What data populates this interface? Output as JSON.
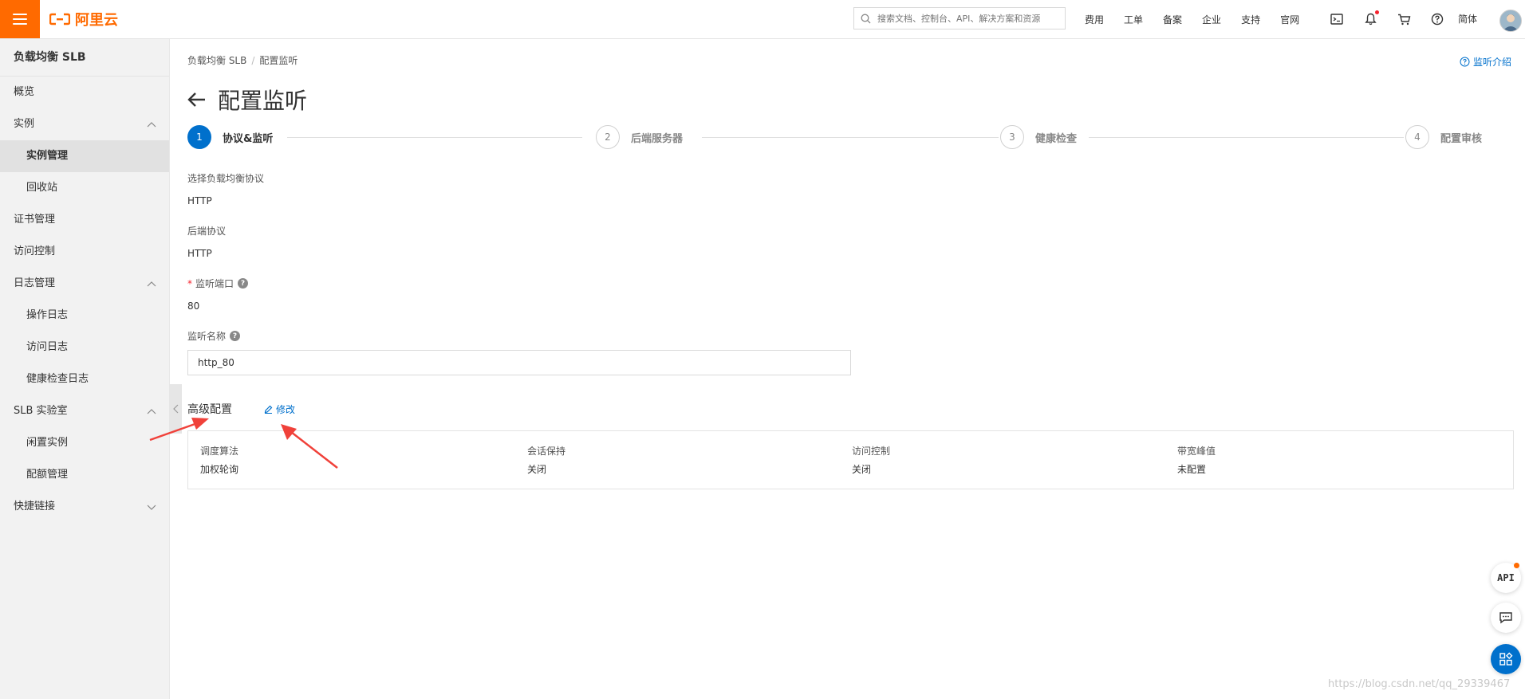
{
  "brand": {
    "name": "阿里云",
    "color": "#ff6a00"
  },
  "topbar": {
    "search_placeholder": "搜索文档、控制台、API、解决方案和资源",
    "links": [
      "费用",
      "工单",
      "备案",
      "企业",
      "支持",
      "官网"
    ],
    "icons": [
      "terminal-icon",
      "bell-icon",
      "cart-icon",
      "help-icon"
    ],
    "language": "简体"
  },
  "sidebar": {
    "title": "负载均衡 SLB",
    "items": [
      {
        "label": "概览",
        "level": 0
      },
      {
        "label": "实例",
        "level": 0,
        "chevron": "up"
      },
      {
        "label": "实例管理",
        "level": 1,
        "active": true
      },
      {
        "label": "回收站",
        "level": 1
      },
      {
        "label": "证书管理",
        "level": 0
      },
      {
        "label": "访问控制",
        "level": 0
      },
      {
        "label": "日志管理",
        "level": 0,
        "chevron": "up"
      },
      {
        "label": "操作日志",
        "level": 1
      },
      {
        "label": "访问日志",
        "level": 1
      },
      {
        "label": "健康检查日志",
        "level": 1
      },
      {
        "label": "SLB 实验室",
        "level": 0,
        "chevron": "up"
      },
      {
        "label": "闲置实例",
        "level": 1
      },
      {
        "label": "配额管理",
        "level": 1
      },
      {
        "label": "快捷链接",
        "level": 0,
        "chevron": "down"
      }
    ]
  },
  "breadcrumb": {
    "root": "负载均衡 SLB",
    "separator": "/",
    "current": "配置监听"
  },
  "help_link": "监听介绍",
  "page_title": "配置监听",
  "steps": [
    {
      "num": "1",
      "label": "协议&监听",
      "active": true
    },
    {
      "num": "2",
      "label": "后端服务器"
    },
    {
      "num": "3",
      "label": "健康检查"
    },
    {
      "num": "4",
      "label": "配置审核"
    }
  ],
  "form": {
    "lb_protocol_label": "选择负载均衡协议",
    "lb_protocol_value": "HTTP",
    "backend_protocol_label": "后端协议",
    "backend_protocol_value": "HTTP",
    "port_required_mark": "*",
    "port_label": "监听端口",
    "port_value": "80",
    "name_label": "监听名称",
    "name_value": "http_80"
  },
  "advanced": {
    "title": "高级配置",
    "edit_label": "修改",
    "items": [
      {
        "key": "调度算法",
        "value": "加权轮询"
      },
      {
        "key": "会话保持",
        "value": "关闭"
      },
      {
        "key": "访问控制",
        "value": "关闭"
      },
      {
        "key": "带宽峰值",
        "value": "未配置"
      }
    ]
  },
  "floating": {
    "api_label": "API"
  },
  "watermark": "https://blog.csdn.net/qq_29339467",
  "colors": {
    "primary": "#0070cc",
    "annotation_arrow": "#f0413a"
  }
}
